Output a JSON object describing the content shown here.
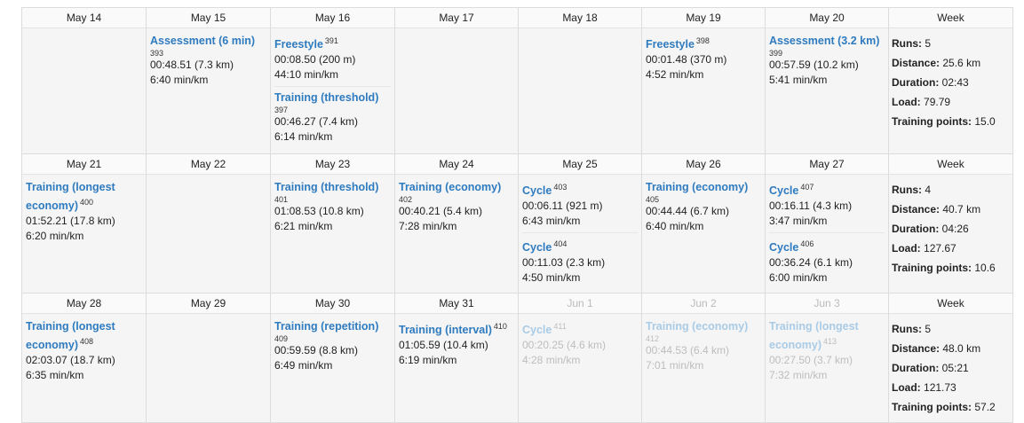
{
  "week_label": "Week",
  "weeks": [
    {
      "days": [
        {
          "date": "May 14",
          "activities": []
        },
        {
          "date": "May 15",
          "activities": [
            {
              "title": "Assessment (6 min)",
              "id": "393",
              "id_inline": false,
              "lines": [
                "00:48.51 (7.3 km)",
                "6:40 min/km"
              ]
            }
          ]
        },
        {
          "date": "May 16",
          "activities": [
            {
              "title": "Freestyle",
              "id": "391",
              "id_inline": true,
              "lines": [
                "00:08.50 (200 m)",
                "44:10 min/km"
              ]
            },
            {
              "title": "Training (threshold)",
              "id": "397",
              "id_inline": false,
              "lines": [
                "00:46.27 (7.4 km)",
                "6:14 min/km"
              ]
            }
          ]
        },
        {
          "date": "May 17",
          "activities": []
        },
        {
          "date": "May 18",
          "activities": []
        },
        {
          "date": "May 19",
          "activities": [
            {
              "title": "Freestyle",
              "id": "398",
              "id_inline": true,
              "lines": [
                "00:01.48 (370 m)",
                "4:52 min/km"
              ]
            }
          ]
        },
        {
          "date": "May 20",
          "activities": [
            {
              "title": "Assessment (3.2 km)",
              "id": "399",
              "id_inline": false,
              "lines": [
                "00:57.59 (10.2 km)",
                "5:41 min/km"
              ]
            }
          ]
        }
      ],
      "summary": {
        "runs_label": "Runs:",
        "runs": "5",
        "distance_label": "Distance:",
        "distance": "25.6 km",
        "duration_label": "Duration:",
        "duration": "02:43",
        "load_label": "Load:",
        "load": "79.79",
        "points_label": "Training points:",
        "points": "15.0"
      }
    },
    {
      "days": [
        {
          "date": "May 21",
          "activities": [
            {
              "title": "Training (longest economy)",
              "id": "400",
              "id_inline": true,
              "lines": [
                "01:52.21 (17.8 km)",
                "6:20 min/km"
              ]
            }
          ]
        },
        {
          "date": "May 22",
          "activities": []
        },
        {
          "date": "May 23",
          "activities": [
            {
              "title": "Training (threshold)",
              "id": "401",
              "id_inline": false,
              "lines": [
                "01:08.53 (10.8 km)",
                "6:21 min/km"
              ]
            }
          ]
        },
        {
          "date": "May 24",
          "activities": [
            {
              "title": "Training (economy)",
              "id": "402",
              "id_inline": false,
              "lines": [
                "00:40.21 (5.4 km)",
                "7:28 min/km"
              ]
            }
          ]
        },
        {
          "date": "May 25",
          "activities": [
            {
              "title": "Cycle",
              "id": "403",
              "id_inline": true,
              "lines": [
                "00:06.11 (921 m)",
                "6:43 min/km"
              ]
            },
            {
              "title": "Cycle",
              "id": "404",
              "id_inline": true,
              "lines": [
                "00:11.03 (2.3 km)",
                "4:50 min/km"
              ]
            }
          ]
        },
        {
          "date": "May 26",
          "activities": [
            {
              "title": "Training (economy)",
              "id": "405",
              "id_inline": false,
              "lines": [
                "00:44.44 (6.7 km)",
                "6:40 min/km"
              ]
            }
          ]
        },
        {
          "date": "May 27",
          "activities": [
            {
              "title": "Cycle",
              "id": "407",
              "id_inline": true,
              "lines": [
                "00:16.11 (4.3 km)",
                "3:47 min/km"
              ]
            },
            {
              "title": "Cycle",
              "id": "406",
              "id_inline": true,
              "lines": [
                "00:36.24 (6.1 km)",
                "6:00 min/km"
              ]
            }
          ]
        }
      ],
      "summary": {
        "runs_label": "Runs:",
        "runs": "4",
        "distance_label": "Distance:",
        "distance": "40.7 km",
        "duration_label": "Duration:",
        "duration": "04:26",
        "load_label": "Load:",
        "load": "127.67",
        "points_label": "Training points:",
        "points": "10.6"
      }
    },
    {
      "days": [
        {
          "date": "May 28",
          "activities": [
            {
              "title": "Training (longest economy)",
              "id": "408",
              "id_inline": true,
              "lines": [
                "02:03.07 (18.7 km)",
                "6:35 min/km"
              ]
            }
          ]
        },
        {
          "date": "May 29",
          "activities": []
        },
        {
          "date": "May 30",
          "activities": [
            {
              "title": "Training (repetition)",
              "id": "409",
              "id_inline": false,
              "lines": [
                "00:59.59 (8.8 km)",
                "6:49 min/km"
              ]
            }
          ]
        },
        {
          "date": "May 31",
          "activities": [
            {
              "title": "Training (interval)",
              "id": "410",
              "id_inline": true,
              "lines": [
                "01:05.59 (10.4 km)",
                "6:19 min/km"
              ]
            }
          ]
        },
        {
          "date": "Jun 1",
          "faded": true,
          "activities": [
            {
              "title": "Cycle",
              "id": "411",
              "id_inline": true,
              "lines": [
                "00:20.25 (4.6 km)",
                "4:28 min/km"
              ]
            }
          ]
        },
        {
          "date": "Jun 2",
          "faded": true,
          "activities": [
            {
              "title": "Training (economy)",
              "id": "412",
              "id_inline": false,
              "lines": [
                "00:44.53 (6.4 km)",
                "7:01 min/km"
              ]
            }
          ]
        },
        {
          "date": "Jun 3",
          "faded": true,
          "activities": [
            {
              "title": "Training (longest economy)",
              "id": "413",
              "id_inline": true,
              "lines": [
                "00:27.50 (3.7 km)",
                "7:32 min/km"
              ]
            }
          ]
        }
      ],
      "summary": {
        "runs_label": "Runs:",
        "runs": "5",
        "distance_label": "Distance:",
        "distance": "48.0 km",
        "duration_label": "Duration:",
        "duration": "05:21",
        "load_label": "Load:",
        "load": "121.73",
        "points_label": "Training points:",
        "points": "57.2"
      }
    }
  ]
}
